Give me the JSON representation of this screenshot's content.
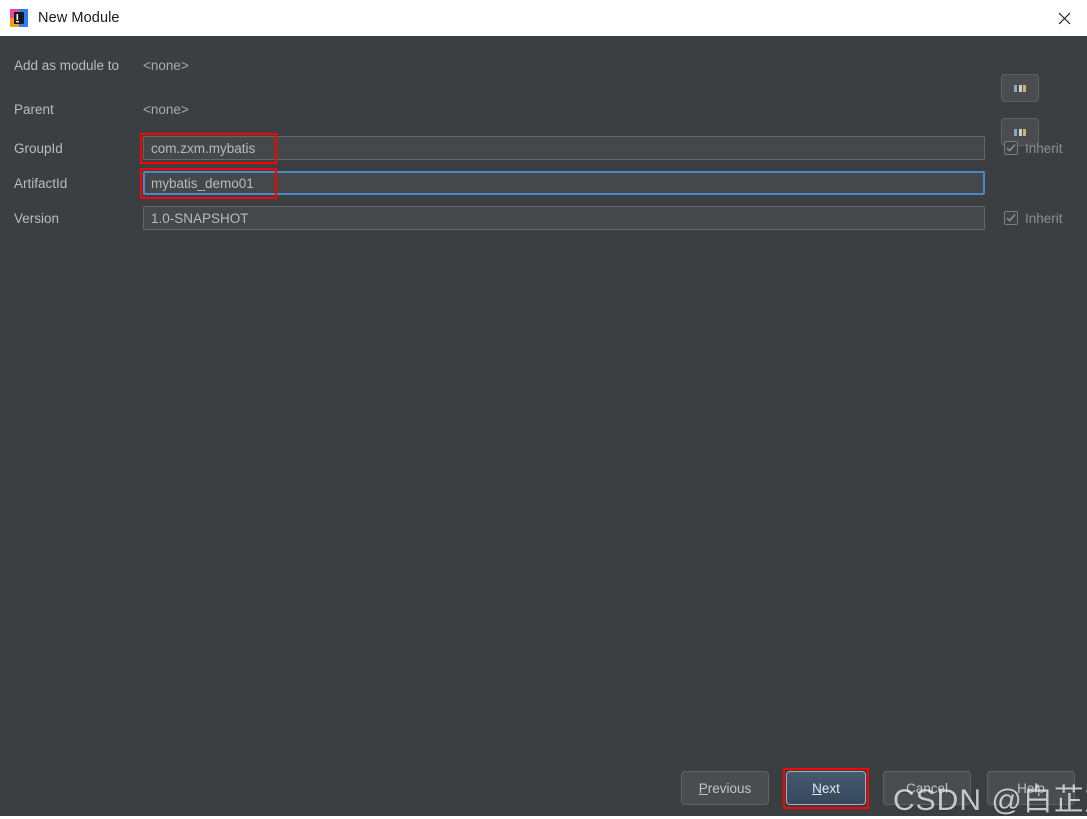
{
  "titlebar": {
    "icon": "intellij-idea-icon",
    "title": "New Module",
    "close_label": "close-icon"
  },
  "form": {
    "rows": [
      {
        "label": "Add as module to",
        "type": "static",
        "value": "<none>",
        "browse": "...",
        "inherit": null
      },
      {
        "label": "Parent",
        "type": "static",
        "value": "<none>",
        "browse": "...",
        "inherit": null
      },
      {
        "label": "GroupId",
        "type": "input",
        "value": "com.zxm.mybatis",
        "browse": null,
        "inherit": "Inherit"
      },
      {
        "label": "ArtifactId",
        "type": "input",
        "value": "mybatis_demo01",
        "browse": null,
        "inherit": null
      },
      {
        "label": "Version",
        "type": "input",
        "value": "1.0-SNAPSHOT",
        "browse": null,
        "inherit": "Inherit"
      }
    ]
  },
  "buttons": {
    "previous": "Previous",
    "previous_mnemonic": "P",
    "previous_rest": "revious",
    "next": "Next",
    "next_mnemonic": "N",
    "next_rest": "ext",
    "cancel": "Cancel",
    "help": "Help"
  },
  "watermark": {
    "text": "CSDN @白芷加茯苓"
  },
  "colors": {
    "dialog_bg": "#3c3f41",
    "titlebar_bg": "#ffffff",
    "field_bg": "#45484a",
    "accent_focus": "#4a88c7",
    "primary_button": "#3d5068",
    "annotation": "#ff0000",
    "label_text": "#bbbbbb"
  }
}
